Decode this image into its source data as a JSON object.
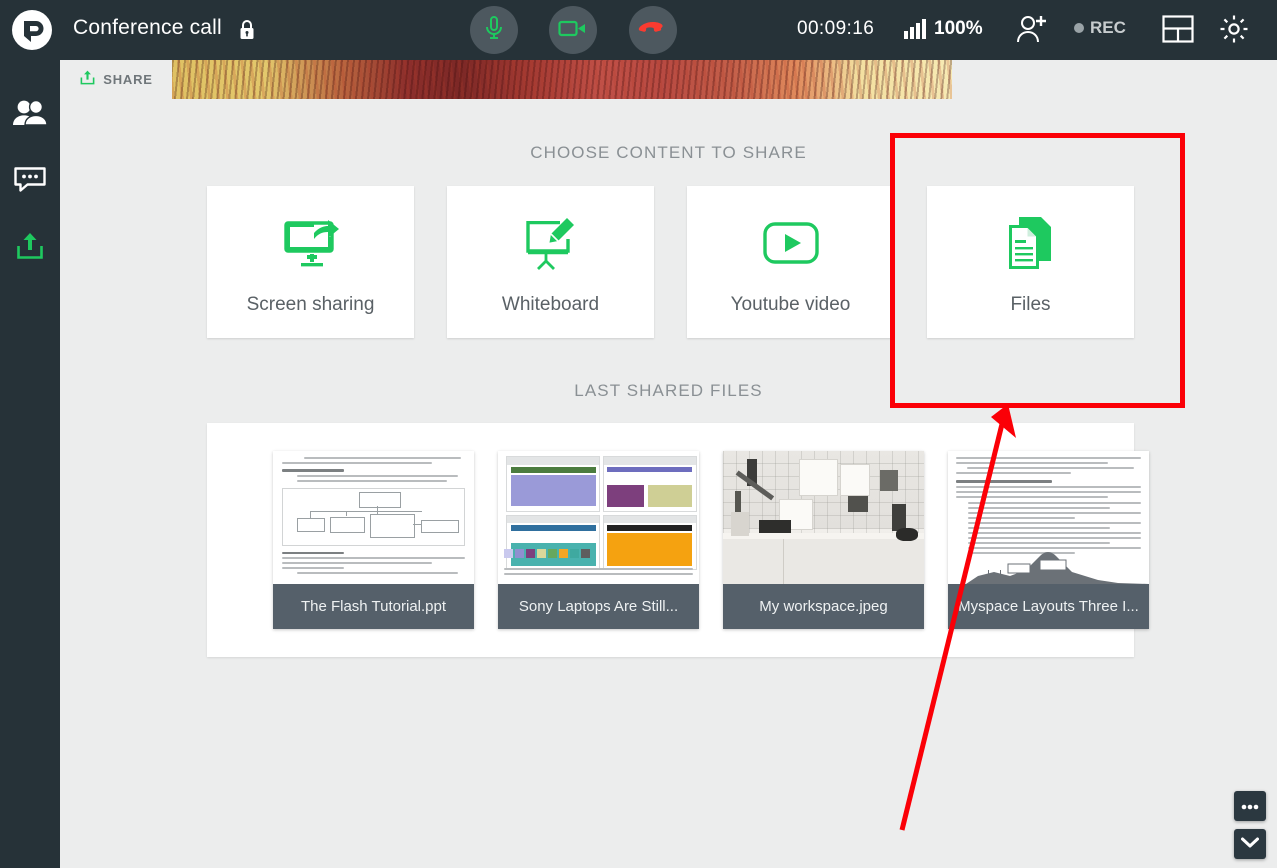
{
  "topbar": {
    "logo_icon": "pruvan-logo-icon",
    "call_title": "Conference call",
    "lock_icon": "lock-icon",
    "mic_icon": "microphone-icon",
    "camera_icon": "video-camera-icon",
    "hangup_icon": "hangup-phone-icon",
    "timer": "00:09:16",
    "signal_icon": "signal-bars-icon",
    "battery": "100%",
    "add_user_icon": "add-user-icon",
    "rec_label": "REC",
    "layout_icon": "layout-grid-icon",
    "settings_icon": "gear-icon",
    "accent_green": "#1ec95f",
    "accent_red": "#fa3b30",
    "bar_bg": "#263238"
  },
  "sidebar": {
    "items": [
      {
        "name": "participants",
        "icon": "participants-icon",
        "active": false
      },
      {
        "name": "chat",
        "icon": "chat-bubble-icon",
        "active": false
      },
      {
        "name": "share",
        "icon": "share-upload-icon",
        "active": true
      }
    ]
  },
  "tabs": [
    {
      "label": "SHARE",
      "icon": "share-upload-icon",
      "active": true
    }
  ],
  "main": {
    "choose_heading": "CHOOSE CONTENT TO SHARE",
    "last_heading": "LAST SHARED FILES",
    "share_options": [
      {
        "label": "Screen sharing",
        "icon": "screen-share-icon"
      },
      {
        "label": "Whiteboard",
        "icon": "whiteboard-pencil-icon"
      },
      {
        "label": "Youtube video",
        "icon": "play-button-icon"
      },
      {
        "label": "Files",
        "icon": "files-document-icon"
      }
    ],
    "last_shared_files": [
      {
        "name": "The Flash Tutorial.ppt",
        "thumb": "uml-document-page"
      },
      {
        "name": "Sony Laptops Are Still...",
        "thumb": "web-layout-grid"
      },
      {
        "name": "My workspace.jpeg",
        "thumb": "desk-photo"
      },
      {
        "name": "Myspace Layouts Three I...",
        "thumb": "report-page-with-curve"
      }
    ],
    "swatch_colors": [
      "#c9c9ee",
      "#8f8fd0",
      "#7d3f7d",
      "#d9d79a",
      "#66a85e",
      "#f5a623",
      "#3fa9a0",
      "#5e5e5e"
    ]
  },
  "annotation": {
    "highlight_color": "#fb0007",
    "highlight_target": "Files",
    "arrow_icon": "red-pointer-arrow"
  },
  "floating_buttons": [
    {
      "name": "more-options",
      "icon": "ellipsis-icon"
    },
    {
      "name": "collapse-panel",
      "icon": "chevron-down-icon"
    }
  ]
}
